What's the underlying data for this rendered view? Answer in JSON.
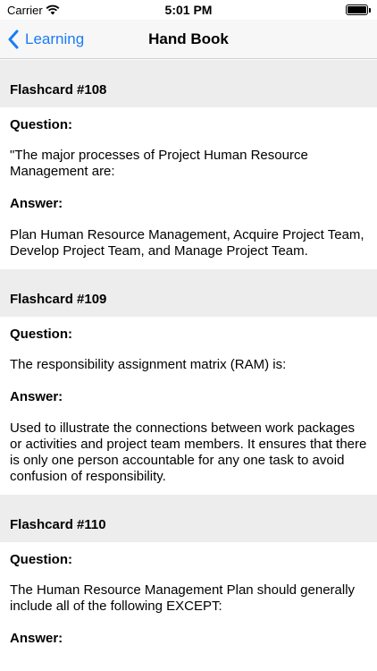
{
  "status_bar": {
    "carrier": "Carrier",
    "time": "5:01 PM"
  },
  "nav": {
    "back_label": "Learning",
    "title": "Hand Book"
  },
  "cards": [
    {
      "header": "Flashcard #108",
      "question_label": "Question:",
      "question": "\"The major processes of Project Human Resource Management are:",
      "answer_label": "Answer:",
      "answer": "Plan Human Resource Management, Acquire Project Team, Develop Project Team, and Manage Project Team."
    },
    {
      "header": "Flashcard #109",
      "question_label": "Question:",
      "question": "The responsibility assignment matrix (RAM) is:",
      "answer_label": "Answer:",
      "answer": "Used to illustrate the connections between work packages or activities and project team members. It ensures that there is only one person accountable for any one task to avoid confusion of responsibility."
    },
    {
      "header": "Flashcard #110",
      "question_label": "Question:",
      "question": "The Human Resource Management Plan should generally include all of the following EXCEPT:",
      "answer_label": "Answer:",
      "answer": ""
    }
  ]
}
